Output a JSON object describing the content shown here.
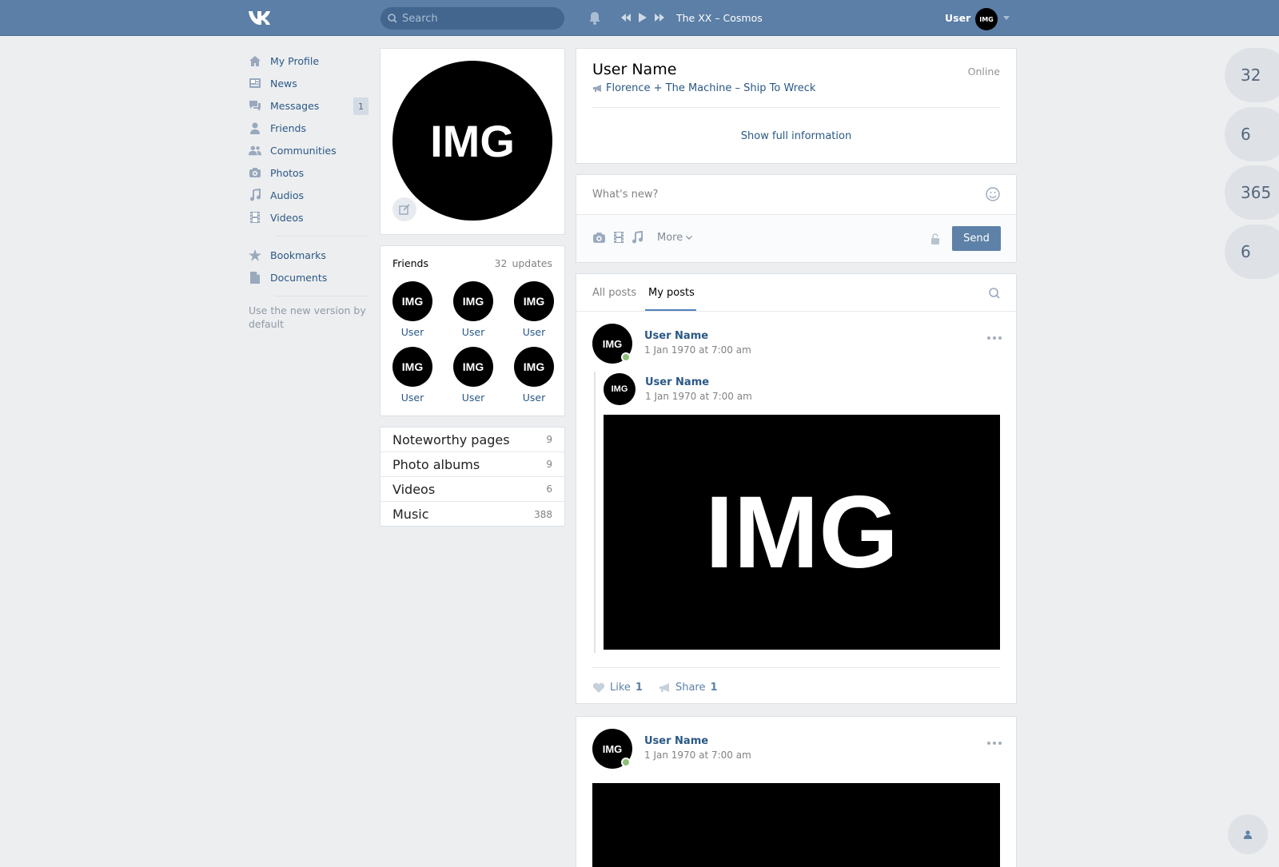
{
  "header": {
    "logo": "VK",
    "search_placeholder": "Search",
    "track": "The XX – Cosmos",
    "user_label": "User",
    "user_avatar": "IMG"
  },
  "menu": {
    "items": [
      {
        "label": "My Profile",
        "icon": "home-icon"
      },
      {
        "label": "News",
        "icon": "news-icon"
      },
      {
        "label": "Messages",
        "icon": "messages-icon",
        "badge": "1"
      },
      {
        "label": "Friends",
        "icon": "friend-icon"
      },
      {
        "label": "Communities",
        "icon": "communities-icon"
      },
      {
        "label": "Photos",
        "icon": "camera-icon"
      },
      {
        "label": "Audios",
        "icon": "music-icon"
      },
      {
        "label": "Videos",
        "icon": "film-icon"
      }
    ],
    "items2": [
      {
        "label": "Bookmarks",
        "icon": "star-icon"
      },
      {
        "label": "Documents",
        "icon": "document-icon"
      }
    ],
    "note": "Use the new version by default"
  },
  "profile": {
    "avatar": "IMG",
    "name": "User Name",
    "online": "Online",
    "status": "Florence + The Machine – Ship To Wreck",
    "show_full": "Show full information"
  },
  "friends": {
    "title": "Friends",
    "count": "32",
    "updates": "updates",
    "list": [
      {
        "avatar": "IMG",
        "name": "User"
      },
      {
        "avatar": "IMG",
        "name": "User"
      },
      {
        "avatar": "IMG",
        "name": "User"
      },
      {
        "avatar": "IMG",
        "name": "User"
      },
      {
        "avatar": "IMG",
        "name": "User"
      },
      {
        "avatar": "IMG",
        "name": "User"
      }
    ]
  },
  "links": [
    {
      "label": "Noteworthy pages",
      "count": "9"
    },
    {
      "label": "Photo albums",
      "count": "9"
    },
    {
      "label": "Videos",
      "count": "6"
    },
    {
      "label": "Music",
      "count": "388"
    }
  ],
  "composer": {
    "placeholder": "What's new?",
    "more": "More",
    "send": "Send"
  },
  "wall": {
    "tabs": [
      "All posts",
      "My posts"
    ],
    "active_tab": "My posts",
    "posts": [
      {
        "avatar": "IMG",
        "author": "User Name",
        "date": "1 Jan 1970 at 7:00 am",
        "repost": {
          "avatar": "IMG",
          "author": "User Name",
          "date": "1 Jan 1970 at 7:00 am",
          "image": "IMG"
        },
        "like_label": "Like",
        "like_count": "1",
        "share_label": "Share",
        "share_count": "1"
      },
      {
        "avatar": "IMG",
        "author": "User Name",
        "date": "1 Jan 1970 at 7:00 am"
      }
    ]
  },
  "counters": [
    "32",
    "6",
    "365",
    "6"
  ],
  "colors": {
    "header_bg": "#5b7fa6",
    "link": "#2a5885",
    "page_bg": "#edeef0",
    "send_button": "#5e81a8",
    "online_dot": "#8ac176"
  }
}
